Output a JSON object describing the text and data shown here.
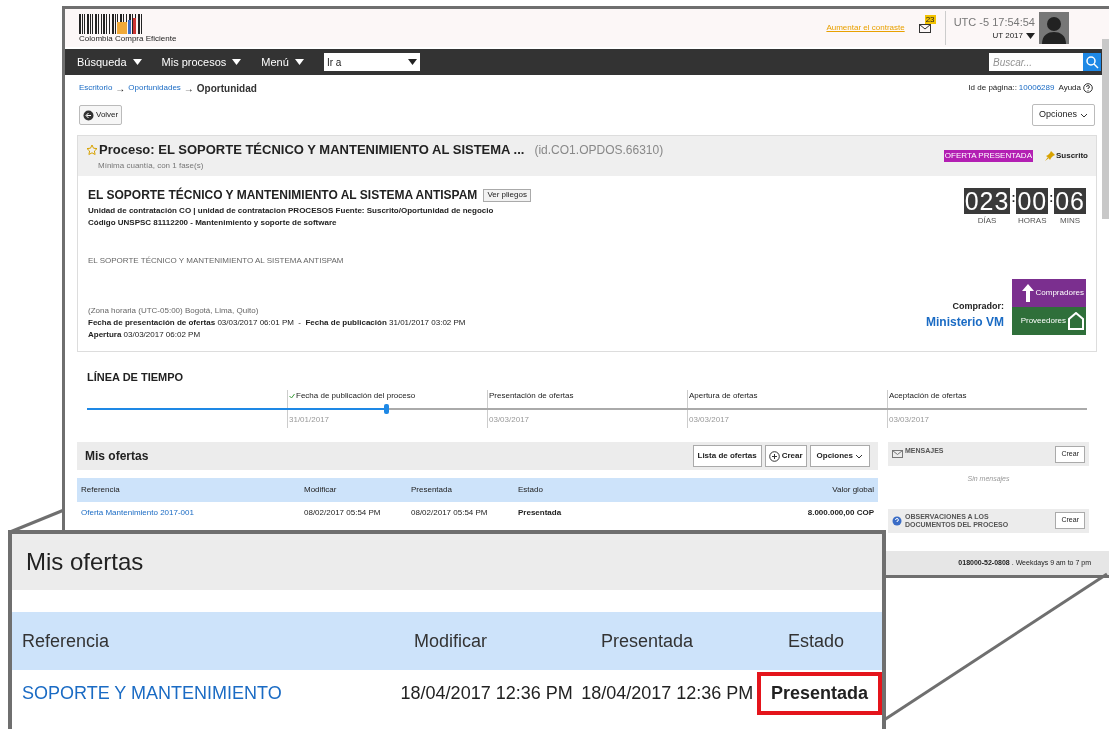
{
  "header": {
    "logo_text": "Colombia Compra Eficiente",
    "contrast_link": "Aumentar el contraste",
    "mail_badge": "23",
    "clock": "UTC -5 17:54:54",
    "user": "UT 2017"
  },
  "nav": {
    "items": [
      "Búsqueda",
      "Mis procesos",
      "Menú"
    ],
    "goto": "Ir a",
    "search_placeholder": "Buscar..."
  },
  "breadcrumb": {
    "items": [
      "Escritorio",
      "Oportunidades"
    ],
    "separator": "→",
    "current": "Oportunidad",
    "page_id_label": "Id de página::",
    "page_id": "10006289",
    "help": "Ayuda"
  },
  "toolbar": {
    "back": "Volver",
    "options": "Opciones"
  },
  "process": {
    "title": "Proceso: EL SOPORTE TÉCNICO Y MANTENIMIENTO AL SISTEMA ...",
    "id": "(id.CO1.OPDOS.66310)",
    "subtitle": "Mínima cuantía, con 1 fase(s)",
    "status": "OFERTA PRESENTADA",
    "subscribed": "Suscrito",
    "name": "EL SOPORTE TÉCNICO Y MANTENIMIENTO AL SISTEMA ANTISPAM",
    "pliegos": "Ver pliegos",
    "unit": "Unidad de contratación CO | unidad de contratacion PROCESOS Fuente: Suscrito/Oportunidad de negocio",
    "code": "Código UNSPSC 81112200 - Mantenimiento y soporte de software",
    "description": "EL SOPORTE TÉCNICO Y MANTENIMIENTO AL SISTEMA ANTISPAM",
    "timezone": "(Zona horaria (UTC-05:00) Bogotá, Lima, Quito)",
    "dates_line": "**Fecha de presentación de ofertas** 03/03/2017 06:01 PM  -  **Fecha de publicación** 31/01/2017 03:02 PM",
    "opening_line": "**Apertura** 03/03/2017 06:02 PM",
    "countdown_separator": ":",
    "countdown": [
      {
        "value": "023",
        "unit": "DÍAS"
      },
      {
        "value": "00",
        "unit": "HORAS"
      },
      {
        "value": "06",
        "unit": "MINS"
      }
    ],
    "buyer_label": "Comprador:",
    "buyer": "Ministerio VM",
    "logo_top": "Compradores",
    "logo_bottom": "Proveedores"
  },
  "timeline": {
    "title": "LÍNEA DE TIEMPO",
    "level": 0.3,
    "stages": [
      {
        "label": "Fecha de publicación del proceso",
        "date": "31/01/2017",
        "done": true
      },
      {
        "label": "Presentación de ofertas",
        "date": "03/03/2017",
        "done": false
      },
      {
        "label": "Apertura de ofertas",
        "date": "03/03/2017",
        "done": false
      },
      {
        "label": "Aceptación de ofertas",
        "date": "03/03/2017",
        "done": false
      }
    ]
  },
  "offers": {
    "title": "Mis ofertas",
    "list_button": "Lista de ofertas",
    "create_button": "Crear",
    "options_button": "Opciones",
    "columns": [
      "Referencia",
      "Modificar",
      "Presentada",
      "Estado",
      "Valor global"
    ],
    "rows": [
      {
        "reference": "Oferta Mantenimiento 2017-001",
        "modified": "08/02/2017 05:54 PM",
        "submitted": "08/02/2017 05:54 PM",
        "status": "Presentada",
        "value": "8.000.000,00 COP"
      }
    ]
  },
  "sidebar": {
    "messages_title": "MENSAJES",
    "messages_create": "Crear",
    "messages_empty": "Sin mensajes",
    "observations_title": "OBSERVACIONES A LOS DOCUMENTOS DEL PROCESO",
    "observations_create": "Crear"
  },
  "footer": {
    "phone": "018000-52-0808",
    "hours": ". Weekdays 9 am to 7 pm"
  },
  "callout": {
    "title": "Mis ofertas",
    "columns": [
      "Referencia",
      "Modificar",
      "Presentada",
      "Estado"
    ],
    "rows": [
      {
        "reference": "SOPORTE Y MANTENIMIENTO",
        "modified": "18/04/2017 12:36 PM",
        "submitted": "18/04/2017 12:36 PM",
        "status": "Presentada",
        "highlighted": true
      }
    ]
  }
}
